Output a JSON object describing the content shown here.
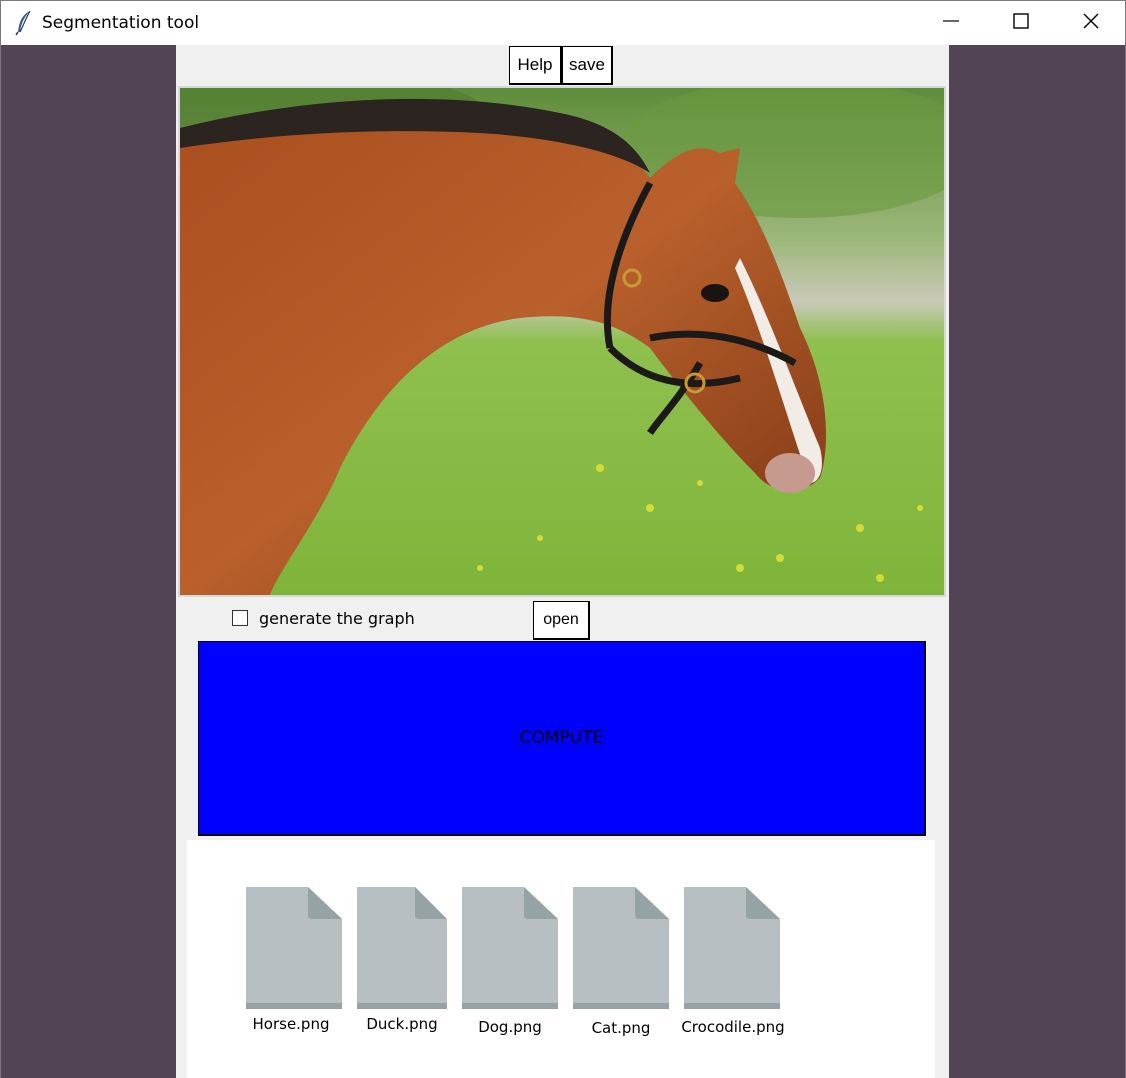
{
  "window": {
    "title": "Segmentation tool",
    "controls": {
      "minimize": "minimize-icon",
      "maximize": "maximize-icon",
      "close": "close-icon"
    }
  },
  "toolbar": {
    "help_label": "Help",
    "save_label": "save"
  },
  "image": {
    "subject": "horse photo"
  },
  "options": {
    "generate_graph_label": "generate the graph",
    "generate_graph_checked": false,
    "open_label": "open"
  },
  "compute": {
    "label": "COMPUTE",
    "color": "#0000fe"
  },
  "files": [
    {
      "name": "Horse.png"
    },
    {
      "name": "Duck.png"
    },
    {
      "name": "Dog.png"
    },
    {
      "name": "Cat.png"
    },
    {
      "name": "Crocodile.png"
    }
  ],
  "colors": {
    "background": "#534455",
    "panel": "#f0f0f0",
    "file_icon": "#b8bfc2",
    "file_icon_fold": "#95a3a4"
  }
}
